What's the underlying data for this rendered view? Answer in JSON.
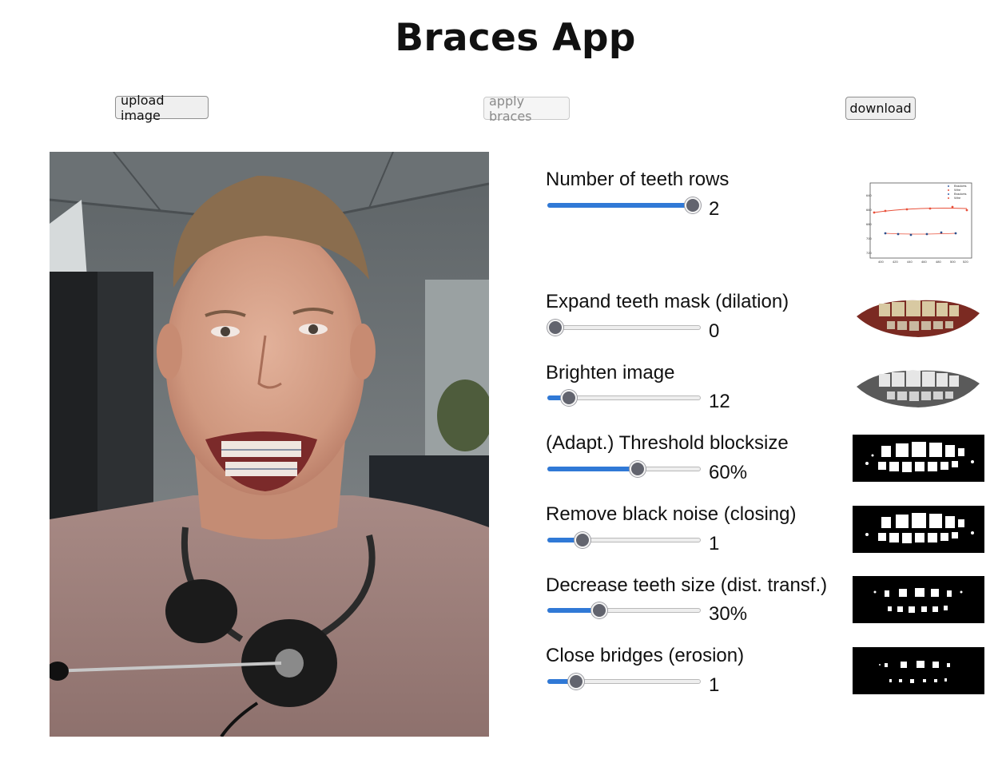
{
  "app": {
    "title": "Braces App"
  },
  "toolbar": {
    "upload_label": "upload image",
    "apply_label": "apply braces",
    "download_label": "download"
  },
  "controls": [
    {
      "label": "Number of teeth rows",
      "value_text": "2",
      "fill": 1.0
    },
    {
      "label": "Expand teeth mask (dilation)",
      "value_text": "0",
      "fill": 0.0
    },
    {
      "label": "Brighten image",
      "value_text": "12",
      "fill": 0.1
    },
    {
      "label": "(Adapt.) Threshold blocksize",
      "value_text": "60%",
      "fill": 0.6
    },
    {
      "label": "Remove black noise (closing)",
      "value_text": "1",
      "fill": 0.2
    },
    {
      "label": "Decrease teeth size (dist. transf.)",
      "value_text": "30%",
      "fill": 0.32
    },
    {
      "label": "Close bridges (erosion)",
      "value_text": "1",
      "fill": 0.15
    }
  ],
  "colors": {
    "slider_fill": "#3079d6",
    "slider_thumb": "#62646e",
    "plot_series_upper": "#e8503a",
    "plot_series_lower": "#2b4f8c"
  },
  "preview_chart": {
    "legend": [
      "Brackets",
      "Wire",
      "Brackets",
      "Wire"
    ],
    "y_ticks": [
      "640",
      "660",
      "680",
      "700",
      "720"
    ],
    "x_ticks": [
      "400",
      "420",
      "440",
      "460",
      "480",
      "500",
      "520"
    ]
  }
}
